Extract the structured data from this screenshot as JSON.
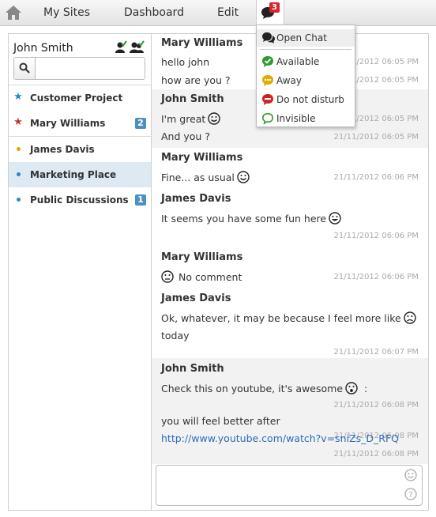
{
  "nav": {
    "home_icon": "home-icon",
    "items": [
      "My Sites",
      "Dashboard",
      "Edit"
    ],
    "chat_notification_count": "3"
  },
  "status_menu": {
    "open_chat": "Open Chat",
    "statuses": [
      {
        "label": "Available",
        "color": "#2e9b2e"
      },
      {
        "label": "Away",
        "color": "#e0a800"
      },
      {
        "label": "Do not disturb",
        "color": "#cc2222"
      },
      {
        "label": "Invisible",
        "color": "#2e9b2e"
      }
    ]
  },
  "user": {
    "name": "John Smith",
    "search_placeholder": ""
  },
  "rooms": [
    {
      "label": "Customer Project",
      "icon": "star-icon",
      "color": "#2a86c9",
      "count": ""
    },
    {
      "label": "Mary Williams",
      "icon": "star-icon",
      "color": "#c0392b",
      "count": "2"
    },
    {
      "label": "James Davis",
      "icon": "dot-icon",
      "color": "#e0a800",
      "count": ""
    },
    {
      "label": "Marketing Place",
      "icon": "dot-icon",
      "color": "#2a86c9",
      "count": "",
      "selected": true
    },
    {
      "label": "Public Discussions",
      "icon": "dot-icon",
      "color": "#2a86c9",
      "count": "1"
    }
  ],
  "messages": [
    {
      "author": "Mary Williams",
      "lines": [
        {
          "text": "hello john",
          "time": "21/11/2012 06:05 PM"
        },
        {
          "text": "how are you ?",
          "time": "21/11/2012 06:05 PM"
        }
      ]
    },
    {
      "author": "John Smith",
      "lines": [
        {
          "text": "I'm great",
          "time": "21/11/2012 06:05 PM"
        },
        {
          "text": "And you ?",
          "time": "21/11/2012 06:05 PM"
        }
      ]
    },
    {
      "author": "Mary Williams",
      "lines": [
        {
          "text": "Fine... as usual",
          "time": "21/11/2012 06:06 PM"
        }
      ]
    },
    {
      "author": "James Davis",
      "lines": [
        {
          "text": "It seems you have some fun here",
          "time": "21/11/2012 06:06 PM"
        }
      ]
    },
    {
      "author": "Mary Williams",
      "lines": [
        {
          "text": "No comment",
          "time": "21/11/2012 06:06 PM"
        }
      ]
    },
    {
      "author": "James Davis",
      "lines": [
        {
          "text": "Ok, whatever, it may be because I feel more like",
          "cont": "today",
          "time": "21/11/2012 06:07 PM"
        }
      ]
    },
    {
      "author": "John Smith",
      "lines": [
        {
          "text": "Check this on youtube, it's awesome",
          "suffix": ":",
          "time": "21/11/2012 06:08 PM"
        },
        {
          "text": "you will feel better after",
          "time": "21/11/2012 06:08 PM"
        },
        {
          "link": "http://www.youtube.com/watch?v=sniZs_D_RFQ",
          "time": "21/11/2012 06:08 PM"
        }
      ]
    }
  ],
  "compose": {
    "placeholder": "",
    "emoticon_icon": "smiley-icon",
    "help_icon": "help-icon"
  }
}
